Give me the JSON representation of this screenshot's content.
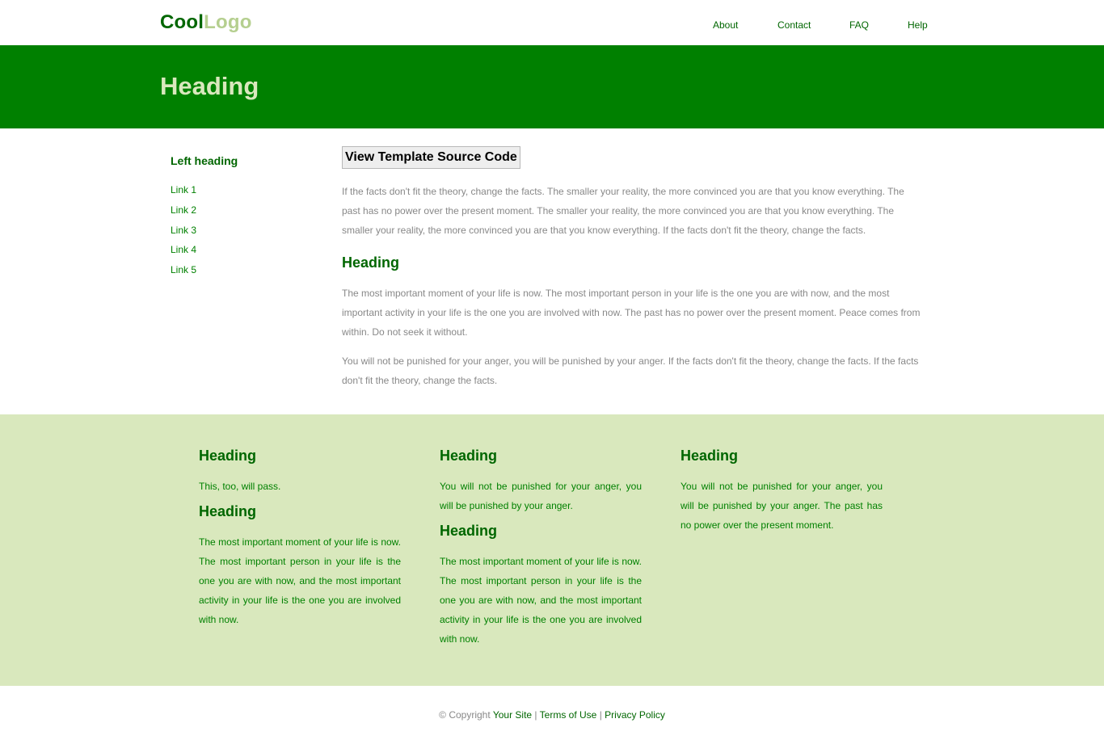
{
  "header": {
    "logo_part1": "Cool",
    "logo_part2": "Logo",
    "nav": [
      "About",
      "Contact",
      "FAQ",
      "Help"
    ]
  },
  "banner": {
    "heading": "Heading"
  },
  "sidebar": {
    "heading": "Left heading",
    "links": [
      "Link 1",
      "Link 2",
      "Link 3",
      "Link 4",
      "Link 5"
    ]
  },
  "main": {
    "button_label": "View Template Source Code",
    "para1": " If the facts don't fit the theory, change the facts. The smaller your reality, the more convinced you are that you know everything. The past has no power over the present moment. The smaller your reality, the more convinced you are that you know everything. The smaller your reality, the more convinced you are that you know everything. If the facts don't fit the theory, change the facts.",
    "heading": "Heading",
    "para2": "The most important moment of your life is now. The most important person in your life is the one you are with now, and the most important activity in your life is the one you are involved with now. The past has no power over the present moment. Peace comes from within. Do not seek it without.",
    "para3": "You will not be punished for your anger, you will be punished by your anger. If the facts don't fit the theory, change the facts. If the facts don't fit the theory, change the facts."
  },
  "footer_columns": [
    {
      "heading1": "Heading",
      "text1": "This, too, will pass.",
      "heading2": "Heading",
      "text2": "The most important moment of your life is now. The most important person in your life is the one you are with now, and the most important activity in your life is the one you are involved with now."
    },
    {
      "heading1": "Heading",
      "text1": "You will not be punished for your anger, you will be punished by your anger.",
      "heading2": "Heading",
      "text2": "The most important moment of your life is now. The most important person in your life is the one you are with now, and the most important activity in your life is the one you are involved with now."
    },
    {
      "heading1": "Heading",
      "text1": "You will not be punished for your anger, you will be punished by your anger. The past has no power over the present moment."
    }
  ],
  "copyright": {
    "prefix": "© Copyright",
    "site_link": "Your Site",
    "separator": "|",
    "terms_link": "Terms of Use",
    "privacy_link": "Privacy Policy"
  },
  "colors": {
    "brand_dark": "#006600",
    "brand_green": "#008000",
    "logo_light": "#b5cf8f",
    "footer_bg": "#d9e8bd",
    "body_text": "#888888"
  }
}
